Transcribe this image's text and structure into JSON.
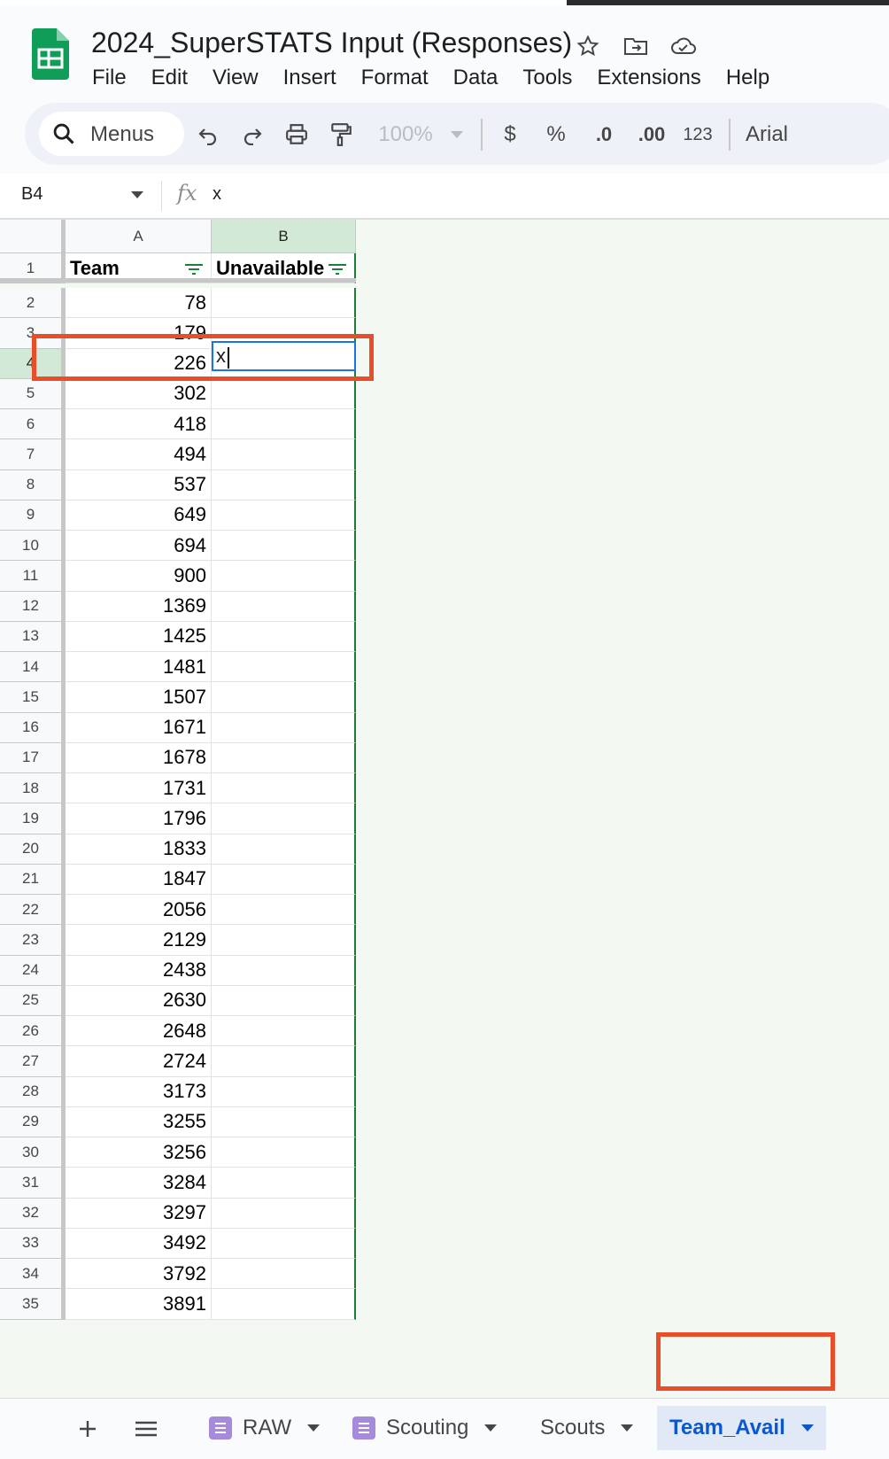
{
  "app": {
    "doc_title": "2024_SuperSTATS Input (Responses)",
    "menu": [
      "File",
      "Edit",
      "View",
      "Insert",
      "Format",
      "Data",
      "Tools",
      "Extensions",
      "Help"
    ]
  },
  "toolbar": {
    "menus_label": "Menus",
    "zoom": "100%",
    "currency": "$",
    "percent": "%",
    "dec_decrease": ".0",
    "dec_increase": ".00",
    "number_format": "123",
    "font": "Arial"
  },
  "formula_bar": {
    "name_box": "B4",
    "fx": "fx",
    "value": "x"
  },
  "columns": [
    "A",
    "B"
  ],
  "header_row": {
    "team": "Team",
    "unavailable": "Unavailable"
  },
  "rows": [
    {
      "n": "1"
    },
    {
      "n": "2",
      "team": "78"
    },
    {
      "n": "3",
      "team": "179"
    },
    {
      "n": "4",
      "team": "226",
      "unavail": "x"
    },
    {
      "n": "5",
      "team": "302"
    },
    {
      "n": "6",
      "team": "418"
    },
    {
      "n": "7",
      "team": "494"
    },
    {
      "n": "8",
      "team": "537"
    },
    {
      "n": "9",
      "team": "649"
    },
    {
      "n": "10",
      "team": "694"
    },
    {
      "n": "11",
      "team": "900"
    },
    {
      "n": "12",
      "team": "1369"
    },
    {
      "n": "13",
      "team": "1425"
    },
    {
      "n": "14",
      "team": "1481"
    },
    {
      "n": "15",
      "team": "1507"
    },
    {
      "n": "16",
      "team": "1671"
    },
    {
      "n": "17",
      "team": "1678"
    },
    {
      "n": "18",
      "team": "1731"
    },
    {
      "n": "19",
      "team": "1796"
    },
    {
      "n": "20",
      "team": "1833"
    },
    {
      "n": "21",
      "team": "1847"
    },
    {
      "n": "22",
      "team": "2056"
    },
    {
      "n": "23",
      "team": "2129"
    },
    {
      "n": "24",
      "team": "2438"
    },
    {
      "n": "25",
      "team": "2630"
    },
    {
      "n": "26",
      "team": "2648"
    },
    {
      "n": "27",
      "team": "2724"
    },
    {
      "n": "28",
      "team": "3173"
    },
    {
      "n": "29",
      "team": "3255"
    },
    {
      "n": "30",
      "team": "3256"
    },
    {
      "n": "31",
      "team": "3284"
    },
    {
      "n": "32",
      "team": "3297"
    },
    {
      "n": "33",
      "team": "3492"
    },
    {
      "n": "34",
      "team": "3792"
    },
    {
      "n": "35",
      "team": "3891"
    }
  ],
  "sheet_tabs": [
    {
      "label": "RAW",
      "icon": "form-sheet-icon",
      "active": false
    },
    {
      "label": "Scouting",
      "icon": "form-sheet-icon",
      "active": false
    },
    {
      "label": "Scouts",
      "active": false
    },
    {
      "label": "Team_Avail",
      "active": true
    }
  ],
  "colors": {
    "selected_header": "#d3e9d7",
    "active_cell_border": "#1a73e8",
    "annotation": "#e94e2a",
    "active_tab_text": "#0b57d0"
  }
}
